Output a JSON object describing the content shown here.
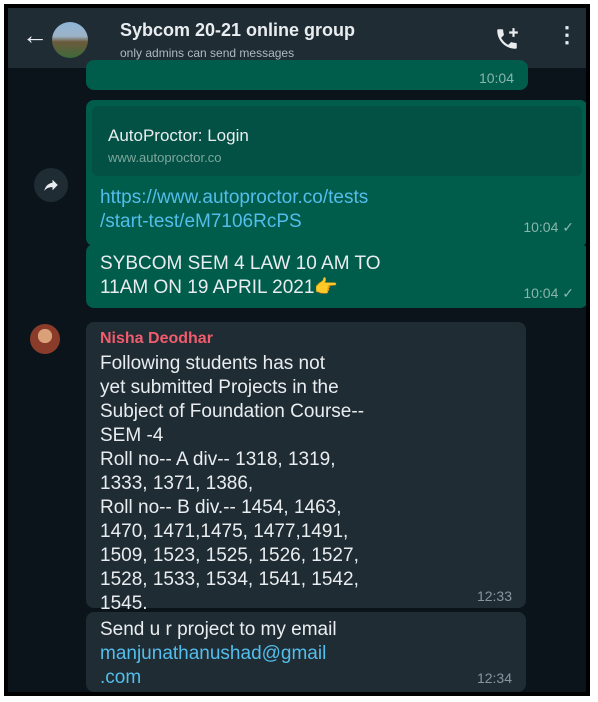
{
  "header": {
    "title": "Sybcom 20-21 online group",
    "subtitle": "only admins can send messages",
    "back_icon": "arrow-left-icon",
    "call_icon": "add-call-icon",
    "menu_icon": "more-vertical-icon"
  },
  "messages": [
    {
      "type": "outgoing",
      "time": "10:04"
    },
    {
      "type": "outgoing",
      "link_title": "AutoProctor: Login",
      "link_domain": "www.autoproctor.co",
      "url_line1": "https://www.autoproctor.co/tests",
      "url_line2": "/start-test/eM7106RcPS",
      "time": "10:04",
      "tick": "✓"
    },
    {
      "type": "outgoing",
      "line1": "SYBCOM SEM 4 LAW 10 AM TO",
      "line2": "11AM ON 19 APRIL 2021",
      "emoji": "👉",
      "time": "10:04",
      "tick": "✓"
    },
    {
      "type": "incoming",
      "sender": "Nisha Deodhar",
      "lines": [
        "Following students has not",
        "yet submitted Projects in the",
        "Subject of Foundation Course--",
        "SEM -4",
        "Roll no-- A div-- 1318, 1319,",
        "1333,  1371,  1386,",
        "Roll no-- B div.--  1454,  1463,",
        "1470, 1471,1475, 1477,1491,",
        "1509,    1523, 1525, 1526, 1527,",
        "1528, 1533, 1534,  1541, 1542,",
        "1545."
      ],
      "time": "12:33"
    },
    {
      "type": "incoming",
      "text": "Send u r project to my email",
      "email_line1": "manjunathanushad@gmail",
      "email_line2": ".com",
      "time": "12:34"
    }
  ],
  "colors": {
    "background": "#0b141a",
    "header": "#1f2c34",
    "outgoing_bubble": "#005c4b",
    "incoming_bubble": "#1f2c34",
    "link": "#53bdeb",
    "sender_name": "#f15c6d"
  }
}
